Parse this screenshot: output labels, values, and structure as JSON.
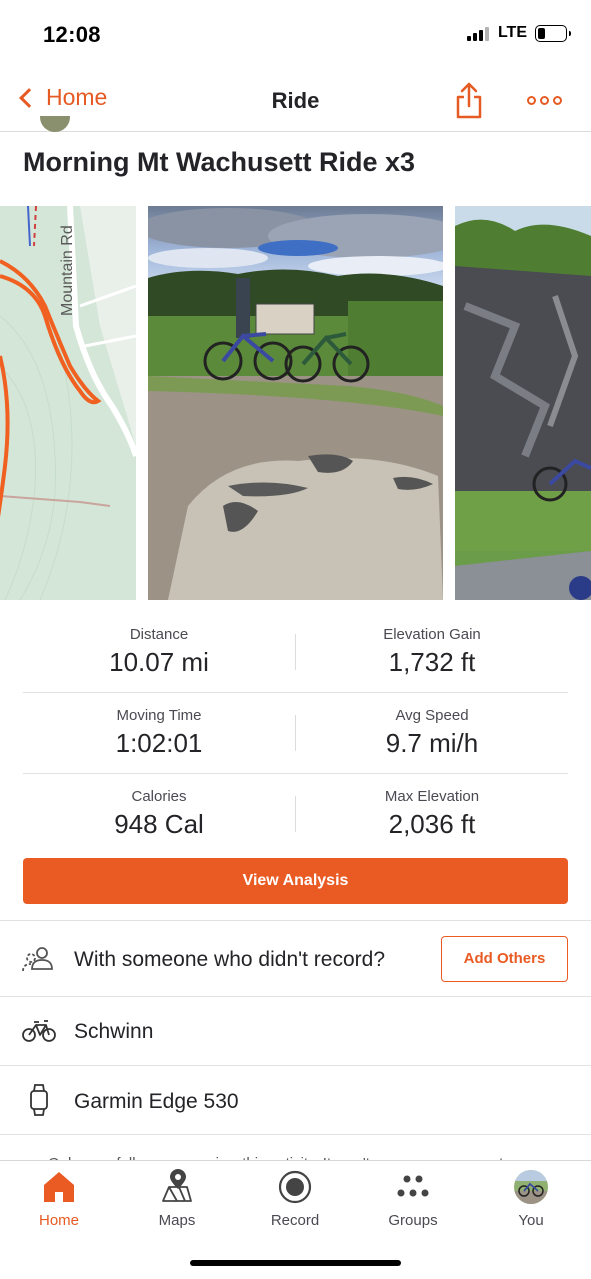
{
  "status_bar": {
    "time": "12:08",
    "network": "LTE",
    "battery_level": 0.25,
    "signal_bars": 3
  },
  "nav": {
    "back_label": "Home",
    "title": "Ride"
  },
  "activity": {
    "title": "Morning Mt Wachusett Ride x3"
  },
  "media": {
    "map_road_label": "Mountain Rd"
  },
  "stats": [
    {
      "left": {
        "label": "Distance",
        "value": "10.07 mi"
      },
      "right": {
        "label": "Elevation Gain",
        "value": "1,732 ft"
      }
    },
    {
      "left": {
        "label": "Moving Time",
        "value": "1:02:01"
      },
      "right": {
        "label": "Avg Speed",
        "value": "9.7 mi/h"
      }
    },
    {
      "left": {
        "label": "Calories",
        "value": "948 Cal"
      },
      "right": {
        "label": "Max Elevation",
        "value": "2,036 ft"
      }
    }
  ],
  "view_analysis_label": "View Analysis",
  "rows": {
    "with_others": {
      "text": "With someone who didn't record?",
      "button": "Add Others",
      "icon": "people-icon"
    },
    "bike": {
      "text": "Schwinn",
      "icon": "bike-icon"
    },
    "device": {
      "text": "Garmin Edge 530",
      "icon": "watch-icon"
    },
    "peek": {
      "text": "Only your followers can view this activity. It won't appear on segment..."
    }
  },
  "tabs": [
    {
      "label": "Home",
      "icon": "home-icon",
      "active": true
    },
    {
      "label": "Maps",
      "icon": "maps-icon",
      "active": false
    },
    {
      "label": "Record",
      "icon": "record-icon",
      "active": false
    },
    {
      "label": "Groups",
      "icon": "groups-icon",
      "active": false
    },
    {
      "label": "You",
      "icon": "profile-avatar-icon",
      "active": false
    }
  ],
  "colors": {
    "accent": "#ea5b24",
    "text": "#242428",
    "divider": "#e2e2e4"
  }
}
